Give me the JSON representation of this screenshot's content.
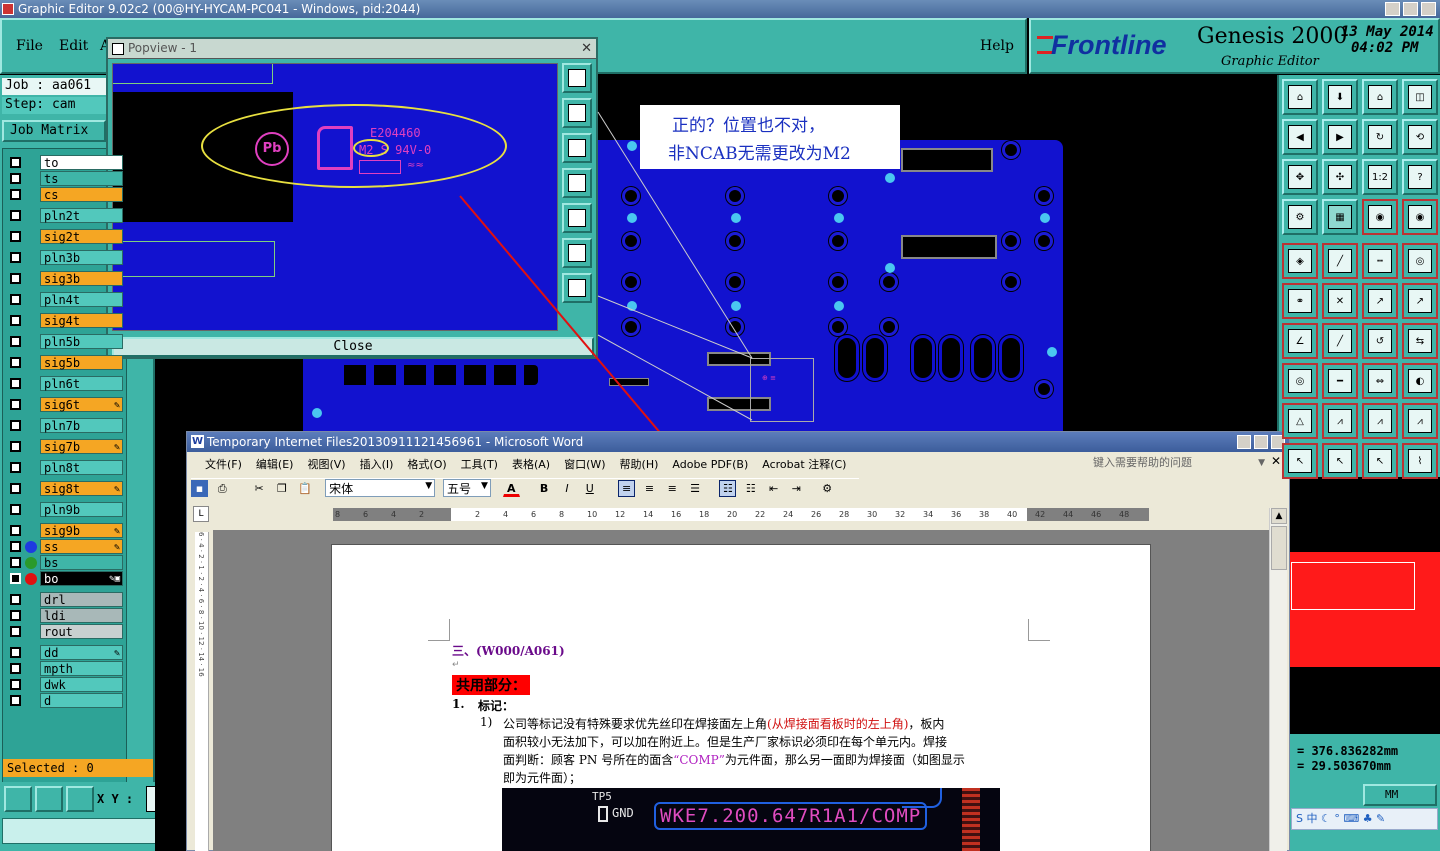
{
  "window": {
    "title": "Graphic Editor 9.02c2 (00@HY-HYCAM-PC041 - Windows, pid:2044)"
  },
  "menu": {
    "file": "File",
    "edit": "Edit",
    "a": "A",
    "help": "Help"
  },
  "brand": {
    "logo": "Frontline",
    "product": "Genesis 2000",
    "subtitle": "Graphic Editor",
    "date": "13 May 2014",
    "time": "04:02 PM"
  },
  "job": {
    "job_label": "Job : aa061",
    "step_label": "Step: cam",
    "matrix_button": "Job Matrix",
    "selected": "Selected : 0",
    "xy_label": "X Y :"
  },
  "layers": [
    {
      "name": "to",
      "color": "#ffffff"
    },
    {
      "name": "ts",
      "color": "#3fb5a8"
    },
    {
      "name": "cs",
      "color": "#f5a623"
    },
    {
      "name": "pln2t",
      "color": "#52c8bc"
    },
    {
      "name": "sig2t",
      "color": "#f5a623"
    },
    {
      "name": "pln3b",
      "color": "#52c8bc"
    },
    {
      "name": "sig3b",
      "color": "#f5a623"
    },
    {
      "name": "pln4t",
      "color": "#52c8bc"
    },
    {
      "name": "sig4t",
      "color": "#f5a623"
    },
    {
      "name": "pln5b",
      "color": "#52c8bc"
    },
    {
      "name": "sig5b",
      "color": "#f5a623"
    },
    {
      "name": "pln6t",
      "color": "#52c8bc"
    },
    {
      "name": "sig6t",
      "color": "#f5a623"
    },
    {
      "name": "pln7b",
      "color": "#52c8bc"
    },
    {
      "name": "sig7b",
      "color": "#f5a623"
    },
    {
      "name": "pln8t",
      "color": "#52c8bc"
    },
    {
      "name": "sig8t",
      "color": "#f5a623"
    },
    {
      "name": "pln9b",
      "color": "#52c8bc"
    },
    {
      "name": "sig9b",
      "color": "#f5a623"
    },
    {
      "name": "ss",
      "color": "#f5a623"
    },
    {
      "name": "bs",
      "color": "#3fb5a8"
    },
    {
      "name": "bo",
      "color": "#000000"
    },
    {
      "name": "drl",
      "color": "#a8b8b8"
    },
    {
      "name": "ldi",
      "color": "#a8b8b8"
    },
    {
      "name": "rout",
      "color": "#c8d0d0"
    },
    {
      "name": "dd",
      "color": "#52c8bc"
    },
    {
      "name": "mpth",
      "color": "#52c8bc"
    },
    {
      "name": "dwk",
      "color": "#52c8bc"
    },
    {
      "name": "d",
      "color": "#52c8bc"
    }
  ],
  "popview": {
    "title": "Popview - 1",
    "close": "Close",
    "marking_code": "E204460",
    "marking_line2": "M2 S 94V-0",
    "pb": "Pb"
  },
  "annotation": {
    "line1": "正的？位置也不对，",
    "line2": "非NCAB无需更改为M2"
  },
  "coords": {
    "x": "= 376.836282mm",
    "y": "= 29.503670mm",
    "unit": "MM"
  },
  "word": {
    "title": "Temporary Internet Files20130911121456961 - Microsoft Word",
    "menus": [
      "文件(F)",
      "编辑(E)",
      "视图(V)",
      "插入(I)",
      "格式(O)",
      "工具(T)",
      "表格(A)",
      "窗口(W)",
      "帮助(H)",
      "Adobe PDF(B)",
      "Acrobat 注释(C)"
    ],
    "help_placeholder": "键入需要帮助的问题",
    "font": "宋体",
    "size": "五号",
    "ruler": [
      "8",
      "6",
      "4",
      "2",
      "",
      "2",
      "4",
      "6",
      "8",
      "10",
      "12",
      "14",
      "16",
      "18",
      "20",
      "22",
      "24",
      "26",
      "28",
      "30",
      "32",
      "34",
      "36",
      "38",
      "40",
      "42",
      "44",
      "46",
      "48"
    ],
    "heading": "三、(W000/A061)",
    "section": "共用部分：",
    "item1": "1.",
    "item1_label": "标记：",
    "para_no": "1)",
    "para_a": "公司等标记没有特殊要求优先丝印在焊接面左上角",
    "para_red": "(从焊接面看板时的左上角)",
    "para_b": "，板内",
    "para_l2": "面积较小无法加下，可以加在附近上。但是生产厂家标识必须印在每个单元内。焊接",
    "para_l3a": "面判断：顾客 PN 号所在的面含",
    "para_comp": "“COMP”",
    "para_l3b": "为元件面，那么另一面即为焊接面（如图显示",
    "para_l4": "即为元件面）；",
    "pcb_tp": "TP5",
    "pcb_gnd": "GND",
    "pcb_pn": "WKE7.200.647R1A1/COMP"
  }
}
